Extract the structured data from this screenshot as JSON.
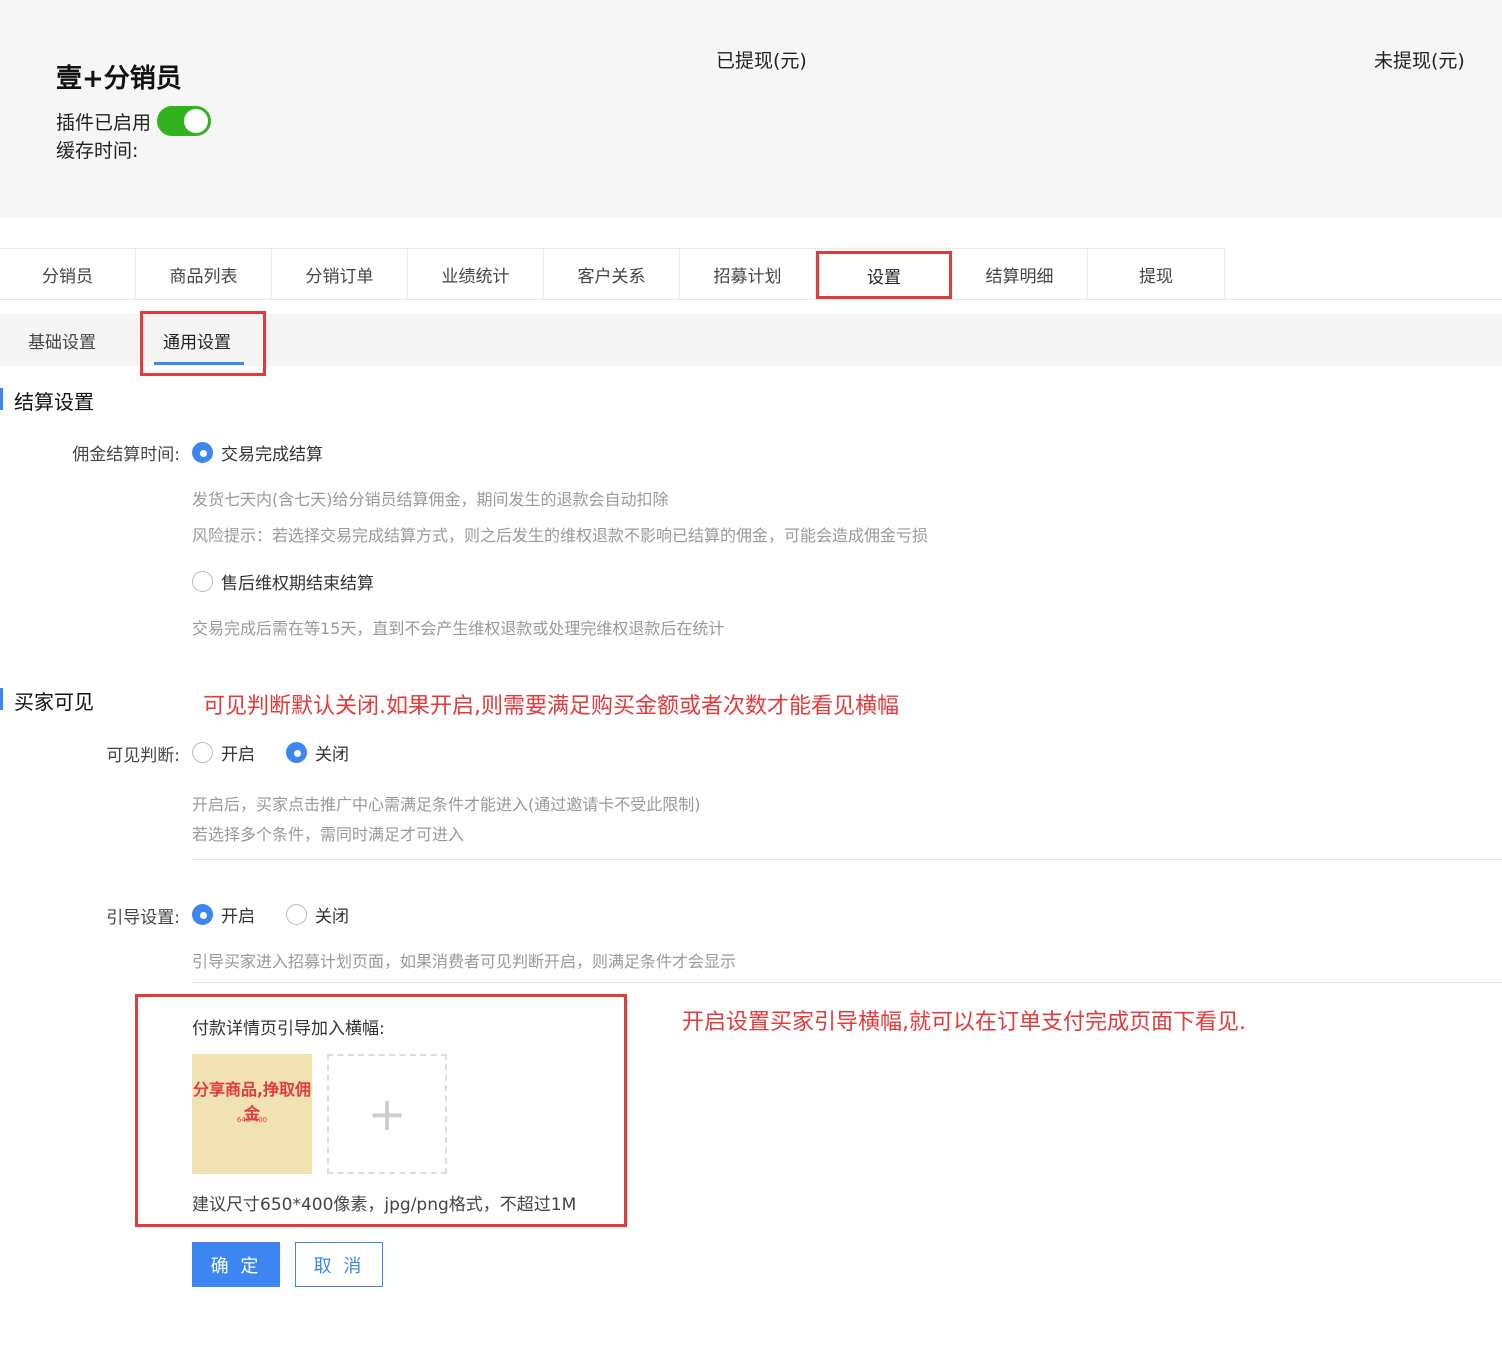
{
  "header": {
    "app_title": "壹+分销员",
    "plugin_status_label": "插件已启用",
    "plugin_enabled": true,
    "cache_time_label": "缓存时间:",
    "withdrawn_label": "已提现(元)",
    "not_withdrawn_label": "未提现(元)"
  },
  "tabs": [
    "分销员",
    "商品列表",
    "分销订单",
    "业绩统计",
    "客户关系",
    "招募计划",
    "设置",
    "结算明细",
    "提现"
  ],
  "active_tab": "设置",
  "subtabs": {
    "basic": "基础设置",
    "general": "通用设置",
    "active": "通用设置"
  },
  "settlement": {
    "section_title": "结算设置",
    "commission_time_label": "佣金结算时间:",
    "option_trade_complete": "交易完成结算",
    "option_trade_complete_selected": true,
    "hint_1": "发货七天内(含七天)给分销员结算佣金，期间发生的退款会自动扣除",
    "hint_2": "风险提示：若选择交易完成结算方式，则之后发生的维权退款不影响已结算的佣金，可能会造成佣金亏损",
    "option_after_sale": "售后维权期结束结算",
    "option_after_sale_selected": false,
    "hint_3": "交易完成后需在等15天，直到不会产生维权退款或处理完维权退款后在统计"
  },
  "buyer_visible": {
    "section_title": "买家可见",
    "annotation": "可见判断默认关闭.如果开启,则需要满足购买金额或者次数才能看见横幅",
    "visibility_label": "可见判断:",
    "visibility_on": "开启",
    "visibility_off": "关闭",
    "visibility_value": "关闭",
    "visibility_hint_1": "开启后，买家点击推广中心需满足条件才能进入(通过邀请卡不受此限制)",
    "visibility_hint_2": "若选择多个条件，需同时满足才可进入",
    "guide_label": "引导设置:",
    "guide_on": "开启",
    "guide_off": "关闭",
    "guide_value": "开启",
    "guide_hint": "引导买家进入招募计划页面，如果消费者可见判断开启，则满足条件才会显示",
    "guide_annotation": "开启设置买家引导横幅,就可以在订单支付完成页面下看见."
  },
  "banner": {
    "label": "付款详情页引导加入横幅:",
    "thumb_title": "分享商品,挣取佣金",
    "thumb_size_text": "640*400",
    "upload_symbol": "+",
    "tip": "建议尺寸650*400像素，jpg/png格式，不超过1M"
  },
  "actions": {
    "confirm": "确 定",
    "cancel": "取 消"
  },
  "colors": {
    "accent": "#3d85f0",
    "toggle_on": "#33b21f",
    "annotation_red": "#e23b3b",
    "banner_bg": "#f0e2b3"
  }
}
